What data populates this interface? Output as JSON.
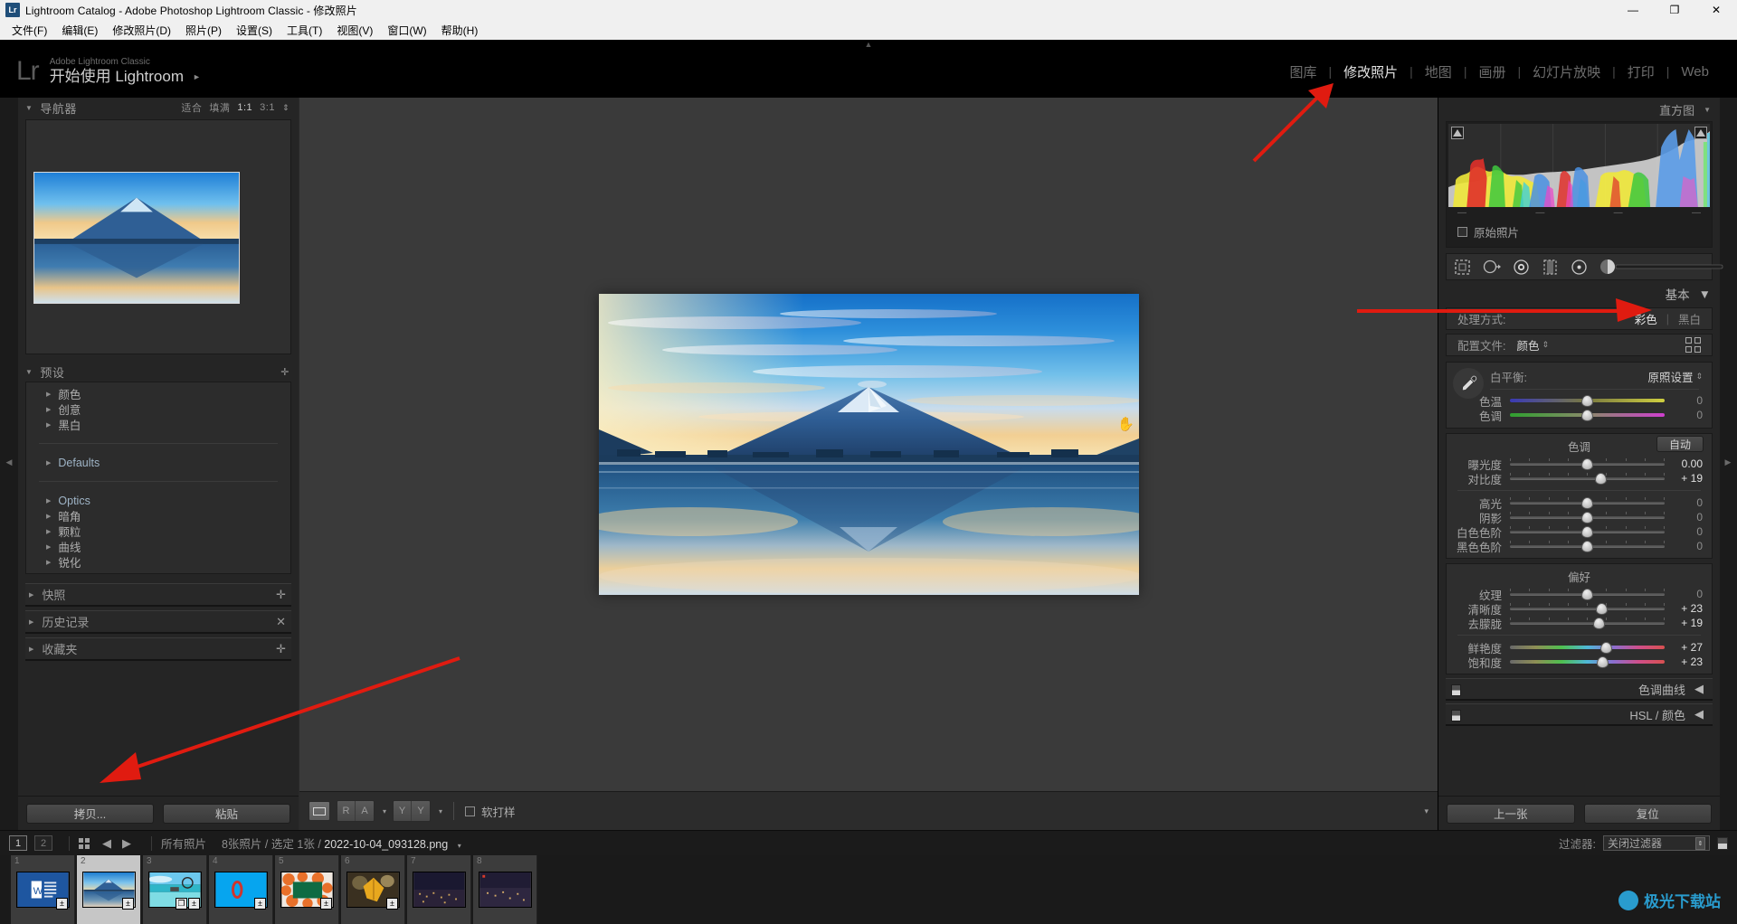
{
  "window": {
    "title": "Lightroom Catalog - Adobe Photoshop Lightroom Classic - 修改照片",
    "app_icon": "Lr",
    "minimize": "—",
    "maximize": "❐",
    "close": "✕"
  },
  "menubar": {
    "items": [
      "文件(F)",
      "编辑(E)",
      "修改照片(D)",
      "照片(P)",
      "设置(S)",
      "工具(T)",
      "视图(V)",
      "窗口(W)",
      "帮助(H)"
    ]
  },
  "identity": {
    "logo": "Lr",
    "line1": "Adobe Lightroom Classic",
    "line2": "开始使用 Lightroom",
    "arrow": "►"
  },
  "modules": {
    "separator": "|",
    "items": [
      {
        "label": "图库",
        "active": false
      },
      {
        "label": "修改照片",
        "active": true
      },
      {
        "label": "地图",
        "active": false
      },
      {
        "label": "画册",
        "active": false
      },
      {
        "label": "幻灯片放映",
        "active": false
      },
      {
        "label": "打印",
        "active": false
      },
      {
        "label": "Web",
        "active": false
      }
    ]
  },
  "left_panel": {
    "navigator": {
      "title": "导航器",
      "triangle": "▼",
      "zoom_levels": [
        "适合",
        "填满",
        "1:1",
        "3:1"
      ],
      "selected_zoom": "1:1",
      "spinner": "⇕"
    },
    "presets": {
      "title": "预设",
      "triangle": "▼",
      "add": "✛",
      "groups": [
        {
          "label": "颜色",
          "lang": "cn"
        },
        {
          "label": "创意",
          "lang": "cn"
        },
        {
          "label": "黑白",
          "lang": "cn"
        },
        {
          "divider": true
        },
        {
          "label": "Defaults",
          "lang": "en"
        },
        {
          "divider": true
        },
        {
          "label": "Optics",
          "lang": "en"
        },
        {
          "label": "暗角",
          "lang": "cn"
        },
        {
          "label": "颗粒",
          "lang": "cn"
        },
        {
          "label": "曲线",
          "lang": "cn"
        },
        {
          "label": "锐化",
          "lang": "cn"
        }
      ]
    },
    "collapsed": [
      {
        "label": "快照",
        "action": "✛"
      },
      {
        "label": "历史记录",
        "action": "✕"
      },
      {
        "label": "收藏夹",
        "action": "✛"
      }
    ],
    "buttons": {
      "copy": "拷贝...",
      "paste": "粘贴"
    }
  },
  "center": {
    "toolbar": {
      "view_loupe_icon": "loupe-view-icon",
      "before_after_pair": [
        "R",
        "A"
      ],
      "yy_pair": [
        "Y",
        "Y"
      ],
      "caret": "▾",
      "soft_proof_label": "软打样",
      "soft_proof_checked": false,
      "expand_caret": "▾"
    },
    "cursor": "✋"
  },
  "right_panel": {
    "histogram": {
      "title": "直方图",
      "triangle": "▼",
      "original_label": "原始照片",
      "original_checked": false,
      "tick": "—"
    },
    "tool_strip": {
      "icons": [
        "crop-tool-icon",
        "spot-removal-icon",
        "red-eye-icon",
        "graduated-filter-icon",
        "radial-filter-icon",
        "adjustment-brush-icon"
      ]
    },
    "basic": {
      "title": "基本",
      "triangle": "▼",
      "treatment_label": "处理方式:",
      "treatment_color": "彩色",
      "treatment_bw": "黑白",
      "treatment_selected": "彩色",
      "profile_label": "配置文件:",
      "profile_value": "颜色",
      "profile_spinner": "⇕",
      "white_balance_label": "白平衡:",
      "white_balance_value": "原照设置",
      "wb_sliders": [
        {
          "name": "色温",
          "value": "0",
          "pos": 50,
          "track": "temp",
          "changed": false
        },
        {
          "name": "色调",
          "value": "0",
          "pos": 50,
          "track": "tint",
          "changed": false
        }
      ],
      "tone_title": "色调",
      "auto_label": "自动",
      "tone_sliders_top": [
        {
          "name": "曝光度",
          "value": "0.00",
          "pos": 50,
          "changed": false
        },
        {
          "name": "对比度",
          "value": "+ 19",
          "pos": 58.5,
          "changed": true
        }
      ],
      "tone_sliders_bottom": [
        {
          "name": "高光",
          "value": "0",
          "pos": 50,
          "changed": false
        },
        {
          "name": "阴影",
          "value": "0",
          "pos": 50,
          "changed": false
        },
        {
          "name": "白色色阶",
          "value": "0",
          "pos": 50,
          "changed": false
        },
        {
          "name": "黑色色阶",
          "value": "0",
          "pos": 50,
          "changed": false
        }
      ],
      "presence_title": "偏好",
      "presence_sliders": [
        {
          "name": "纹理",
          "value": "0",
          "pos": 50,
          "changed": false
        },
        {
          "name": "清晰度",
          "value": "+ 23",
          "pos": 59.5,
          "changed": true
        },
        {
          "name": "去朦胧",
          "value": "+ 19",
          "pos": 57.5,
          "changed": true
        }
      ],
      "saturation_sliders": [
        {
          "name": "鲜艳度",
          "value": "+ 27",
          "pos": 62,
          "track": "vib",
          "changed": true
        },
        {
          "name": "饱和度",
          "value": "+ 23",
          "pos": 60,
          "track": "vib",
          "changed": true
        }
      ]
    },
    "collapsed": [
      {
        "label": "色调曲线",
        "triangle": "◀"
      },
      {
        "label": "HSL / 颜色",
        "triangle": "◀"
      }
    ],
    "buttons": {
      "previous": "上一张",
      "reset": "复位"
    }
  },
  "statusbar": {
    "page_marks": [
      "1",
      "2"
    ],
    "grid_icon": "grid-view-icon",
    "back_arrow": "◀",
    "forward_arrow": "▶",
    "source": "所有照片",
    "count": "8张照片",
    "slash": "/",
    "selected": "选定 1张",
    "filename": "2022-10-04_093128.png",
    "caret": "▾",
    "filter_label": "过滤器:",
    "filter_value": "关闭过滤器"
  },
  "filmstrip": {
    "thumbs": [
      {
        "index": "1",
        "kind": "word-doc",
        "selected": false,
        "badges": [
          "±"
        ]
      },
      {
        "index": "2",
        "kind": "fuji",
        "selected": true,
        "badges": [
          "±"
        ]
      },
      {
        "index": "3",
        "kind": "beach",
        "selected": false,
        "badges": [
          "❐",
          "±"
        ]
      },
      {
        "index": "4",
        "kind": "blue-zero",
        "selected": false,
        "badges": [
          "±"
        ]
      },
      {
        "index": "5",
        "kind": "green-frame",
        "selected": false,
        "badges": [
          "±"
        ]
      },
      {
        "index": "6",
        "kind": "leaf",
        "selected": false,
        "badges": [
          "±"
        ]
      },
      {
        "index": "7",
        "kind": "city-night",
        "selected": false,
        "badges": []
      },
      {
        "index": "8",
        "kind": "city-night2",
        "selected": false,
        "badges": []
      }
    ]
  },
  "watermark": {
    "text": "极光下载站"
  },
  "colors": {
    "accent_red": "#e01b10",
    "panel_bg": "#252525",
    "canvas_bg": "#3a3a3a",
    "text_primary": "#cfcfcf",
    "text_dim": "#8e8e8e"
  }
}
